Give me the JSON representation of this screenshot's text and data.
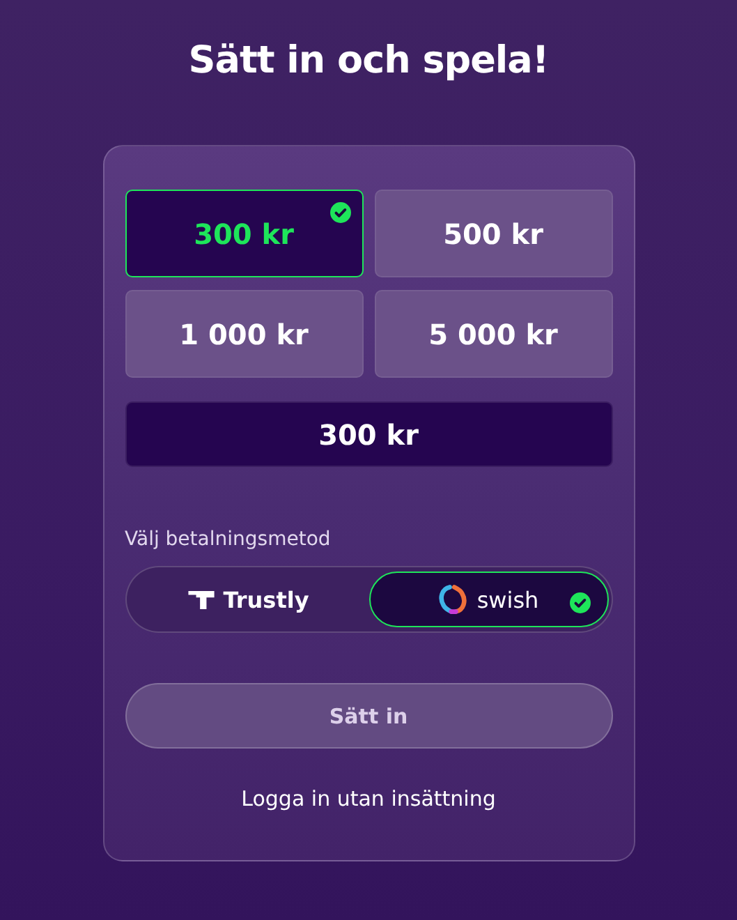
{
  "title": "Sätt in och spela!",
  "amounts": [
    {
      "label": "300 kr",
      "selected": true
    },
    {
      "label": "500 kr",
      "selected": false
    },
    {
      "label": "1 000 kr",
      "selected": false
    },
    {
      "label": "5 000 kr",
      "selected": false
    }
  ],
  "amount_field": {
    "value": "300 kr"
  },
  "payment": {
    "label": "Välj betalningsmetod",
    "methods": [
      {
        "kind": "trustly",
        "label": "Trustly",
        "selected": false
      },
      {
        "kind": "swish",
        "label": "swish",
        "selected": true
      }
    ]
  },
  "deposit_button": {
    "label": "Sätt in",
    "disabled": true
  },
  "login_link": "Logga in utan insättning"
}
